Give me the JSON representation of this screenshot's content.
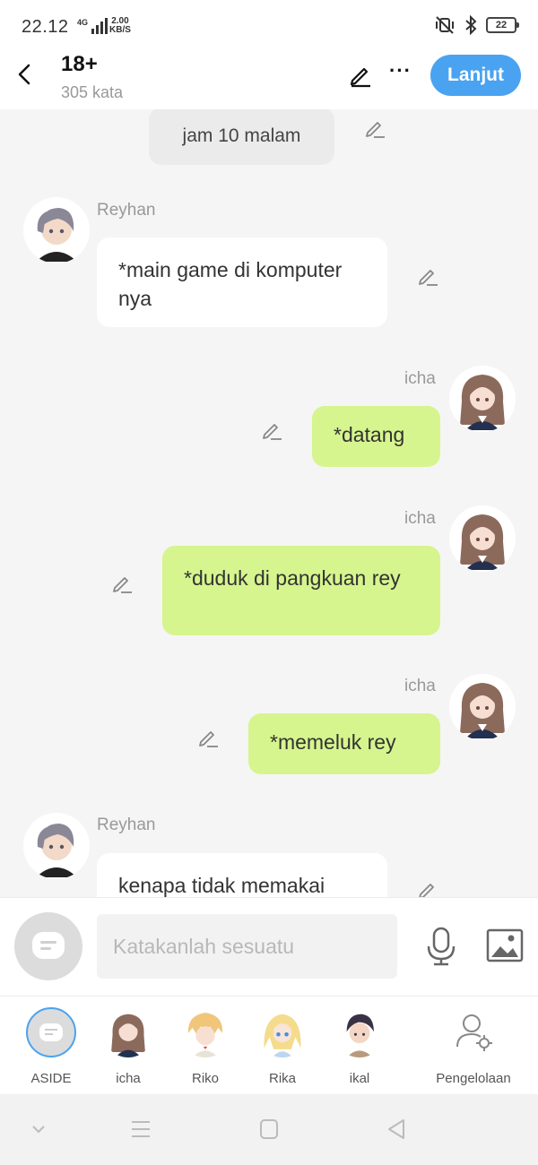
{
  "status_bar": {
    "time": "22.12",
    "network": "4G",
    "speed_value": "2.00",
    "speed_unit": "KB/S",
    "battery": "22"
  },
  "header": {
    "title": "18+",
    "subtitle": "305 kata",
    "next_label": "Lanjut",
    "more_label": "···"
  },
  "chat": {
    "narration": "jam 10 malam",
    "messages": [
      {
        "speaker": "Reyhan",
        "side": "left",
        "text": "*main game di komputer nya"
      },
      {
        "speaker": "icha",
        "side": "right",
        "text": "*datang"
      },
      {
        "speaker": "icha",
        "side": "right",
        "text": "*duduk di pangkuan rey"
      },
      {
        "speaker": "icha",
        "side": "right",
        "text": "*memeluk rey"
      },
      {
        "speaker": "Reyhan",
        "side": "left",
        "text": "kenapa tidak memakai"
      }
    ]
  },
  "input": {
    "placeholder": "Katakanlah sesuatu"
  },
  "characters": [
    {
      "label": "ASIDE"
    },
    {
      "label": "icha"
    },
    {
      "label": "Riko"
    },
    {
      "label": "Rika"
    },
    {
      "label": "ikal"
    },
    {
      "label": "Pengelolaan"
    }
  ],
  "colors": {
    "accent": "#4aa3f0",
    "bubble_right": "#d6f58e",
    "bubble_left": "#ffffff",
    "background": "#f5f5f5"
  }
}
